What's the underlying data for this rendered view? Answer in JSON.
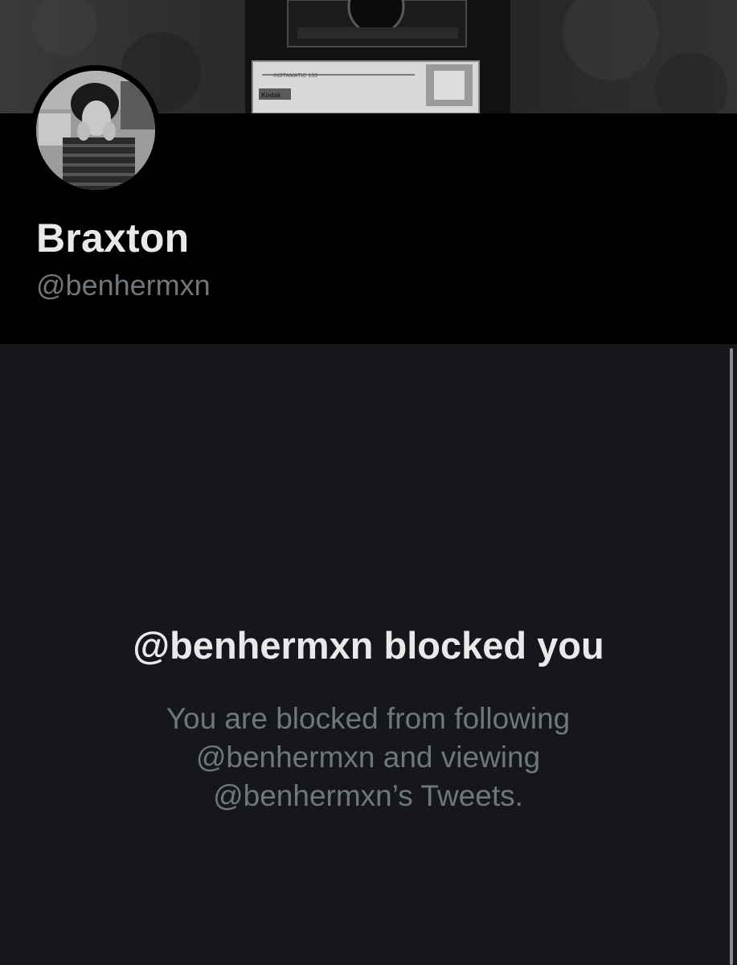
{
  "profile": {
    "display_name": "Braxton",
    "handle": "@benhermxn"
  },
  "blocked": {
    "title": "@benhermxn blocked you",
    "message": "You are blocked from following @benhermxn and viewing @benhermxn’s Tweets."
  },
  "banner": {
    "label_line_1": "INSTAMATIC 133",
    "label_line_2": "Kodak"
  },
  "colors": {
    "background": "#000000",
    "panel_background": "#16171a",
    "primary_text": "#e7e9ea",
    "secondary_text": "#71767b"
  },
  "icons": {
    "avatar": "profile-photo",
    "banner": "camera-photo"
  }
}
